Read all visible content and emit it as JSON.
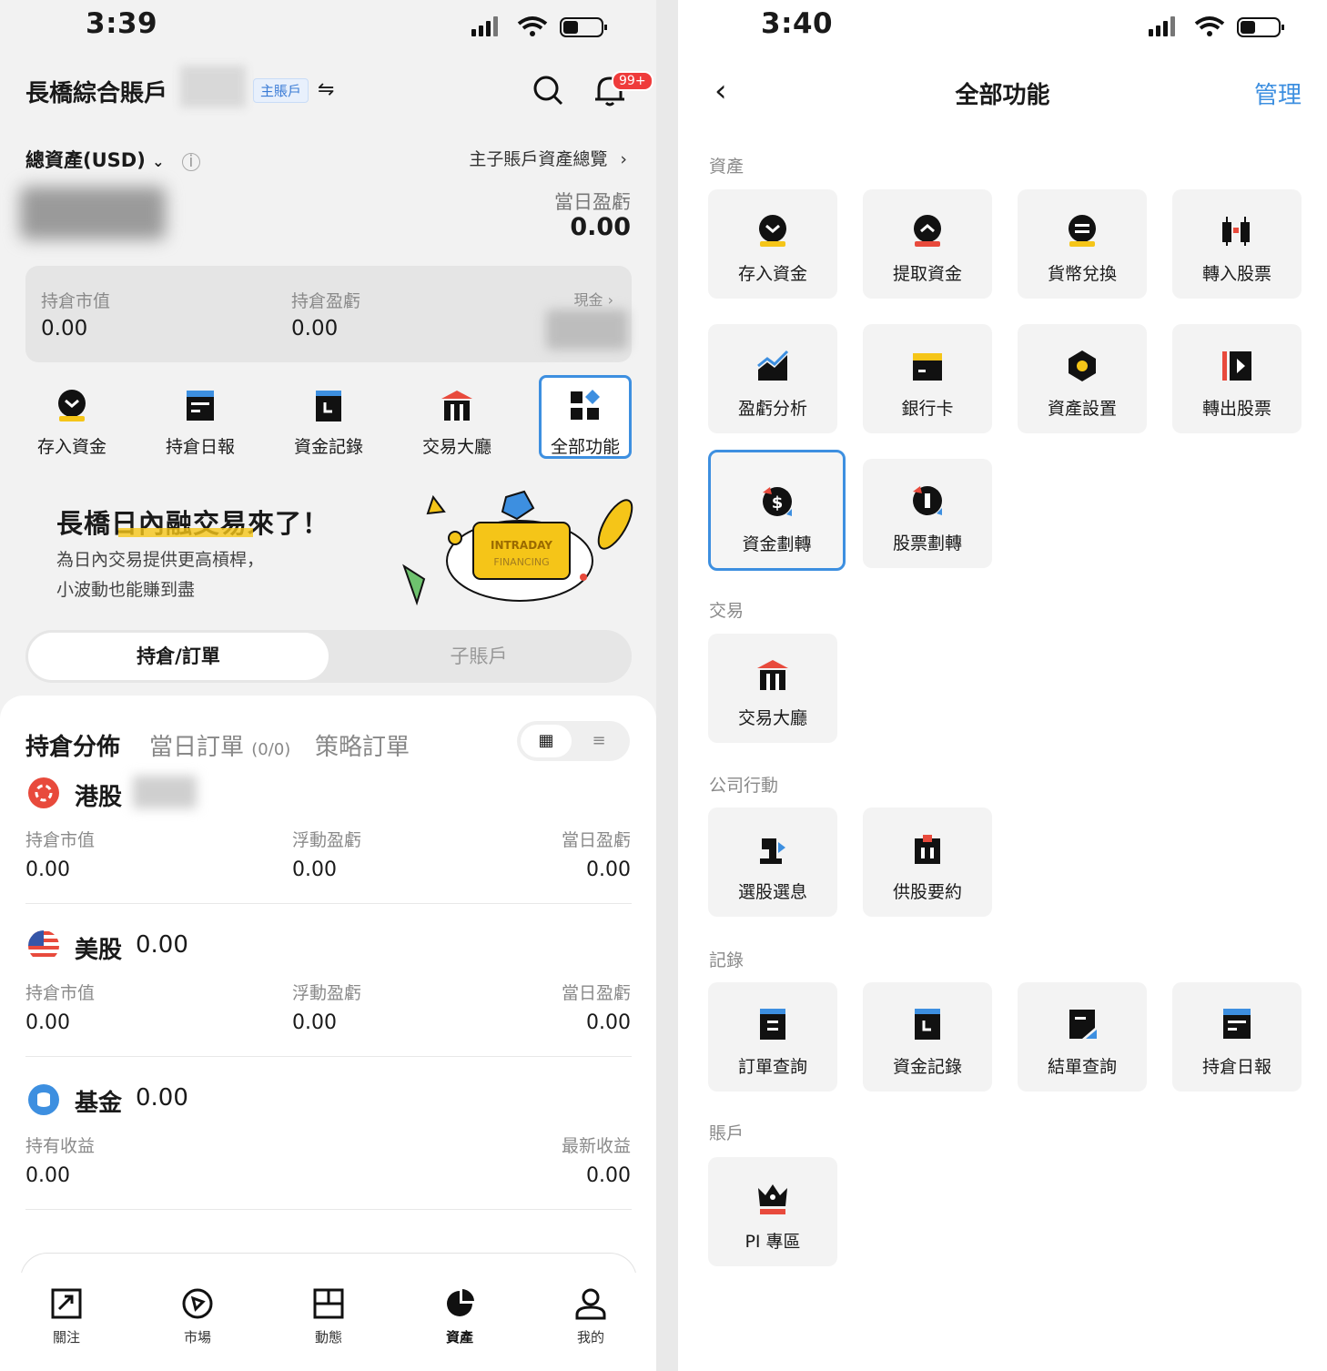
{
  "left": {
    "status": {
      "time": "3:39"
    },
    "header": {
      "account_name": "長橋綜合賬戶",
      "badge": "主賬戶",
      "swap_icon": "swap-icon",
      "notification_count": "99+"
    },
    "summary": {
      "total_label": "總資產(USD)",
      "overview_link": "主子賬戶資產總覽",
      "daypl_label": "當日盈虧",
      "daypl_value": "0.00",
      "position_value_label": "持倉市值",
      "position_value": "0.00",
      "position_pl_label": "持倉盈虧",
      "position_pl": "0.00",
      "cash_label": "現金"
    },
    "quick_actions": [
      {
        "label": "存入資金",
        "icon": "deposit-icon"
      },
      {
        "label": "持倉日報",
        "icon": "daily-report-icon"
      },
      {
        "label": "資金記錄",
        "icon": "fund-record-icon"
      },
      {
        "label": "交易大廳",
        "icon": "trading-hall-icon"
      },
      {
        "label": "全部功能",
        "icon": "all-functions-icon"
      }
    ],
    "promo": {
      "title": "長橋日內融交易來了！",
      "line1": "為日內交易提供更高槓桿，",
      "line2": "小波動也能賺到盡",
      "badge_line1": "INTRADAY",
      "badge_line2": "FINANCING"
    },
    "tabs": {
      "positions": "持倉/訂單",
      "sub_accounts": "子賬戶"
    },
    "panel_tabs": {
      "distribution": "持倉分佈",
      "day_orders": "當日訂單",
      "day_orders_count": "(0/0)",
      "strategy_orders": "策略訂單"
    },
    "markets": {
      "hk": {
        "name": "港股",
        "l1": "持倉市值",
        "v1": "0.00",
        "l2": "浮動盈虧",
        "v2": "0.00",
        "l3": "當日盈虧",
        "v3": "0.00"
      },
      "us": {
        "name": "美股",
        "total": "0.00",
        "l1": "持倉市值",
        "v1": "0.00",
        "l2": "浮動盈虧",
        "v2": "0.00",
        "l3": "當日盈虧",
        "v3": "0.00"
      },
      "fund": {
        "name": "基金",
        "total": "0.00",
        "l1": "持有收益",
        "v1": "0.00",
        "l3": "最新收益",
        "v3": "0.00"
      }
    },
    "bottom_nav": [
      {
        "label": "關注"
      },
      {
        "label": "市場"
      },
      {
        "label": "動態"
      },
      {
        "label": "資產"
      },
      {
        "label": "我的"
      }
    ]
  },
  "right": {
    "status": {
      "time": "3:40"
    },
    "title": "全部功能",
    "manage": "管理",
    "sections": {
      "assets": "資產",
      "trade": "交易",
      "corporate": "公司行動",
      "records": "記錄",
      "account": "賬戶"
    },
    "assets_items": [
      "存入資金",
      "提取資金",
      "貨幣兌換",
      "轉入股票",
      "盈虧分析",
      "銀行卡",
      "資產設置",
      "轉出股票",
      "資金劃轉",
      "股票劃轉"
    ],
    "trade_items": [
      "交易大廳"
    ],
    "corporate_items": [
      "選股選息",
      "供股要約"
    ],
    "records_items": [
      "訂單查詢",
      "資金記錄",
      "結單查詢",
      "持倉日報"
    ],
    "account_items": [
      "PI 專區"
    ]
  },
  "colors": {
    "accent": "#3d8fe0",
    "yellow": "#f5c518",
    "red": "#e84a3c"
  }
}
